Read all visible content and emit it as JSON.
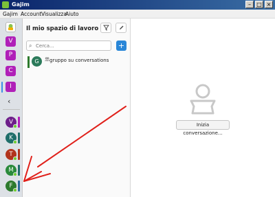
{
  "window": {
    "title": "Gajim"
  },
  "menu": [
    "Gajim",
    "Account",
    "Visualizza",
    "Aiuto"
  ],
  "workspaces": [
    {
      "letter": "V",
      "color": "#b020b8"
    },
    {
      "letter": "P",
      "color": "#b020b8"
    },
    {
      "letter": "C",
      "color": "#b020b8"
    },
    {
      "letter": "I",
      "color": "#b020b8"
    }
  ],
  "accounts": [
    {
      "letter": "V",
      "color": "#6e1f8a",
      "mark": "#b020b8"
    },
    {
      "letter": "K",
      "color": "#1f6e6a",
      "mark": "#1f6e6a"
    },
    {
      "letter": "T",
      "color": "#b2341c",
      "mark": "#b2341c"
    },
    {
      "letter": "M",
      "color": "#2a8a3a",
      "mark": "#1f6e6a"
    },
    {
      "letter": "F",
      "color": "#2d7a2d",
      "mark": "#2a6a9a"
    }
  ],
  "panel": {
    "title": "Il mio spazio di lavoro",
    "search_placeholder": "Cerca...",
    "chats": [
      {
        "letter": "G",
        "name": "gruppo su conversations"
      }
    ]
  },
  "main": {
    "start_button": "Inizia conversazione..."
  },
  "colors": {
    "accent": "#2a87d8",
    "arrow": "#e0201a"
  }
}
